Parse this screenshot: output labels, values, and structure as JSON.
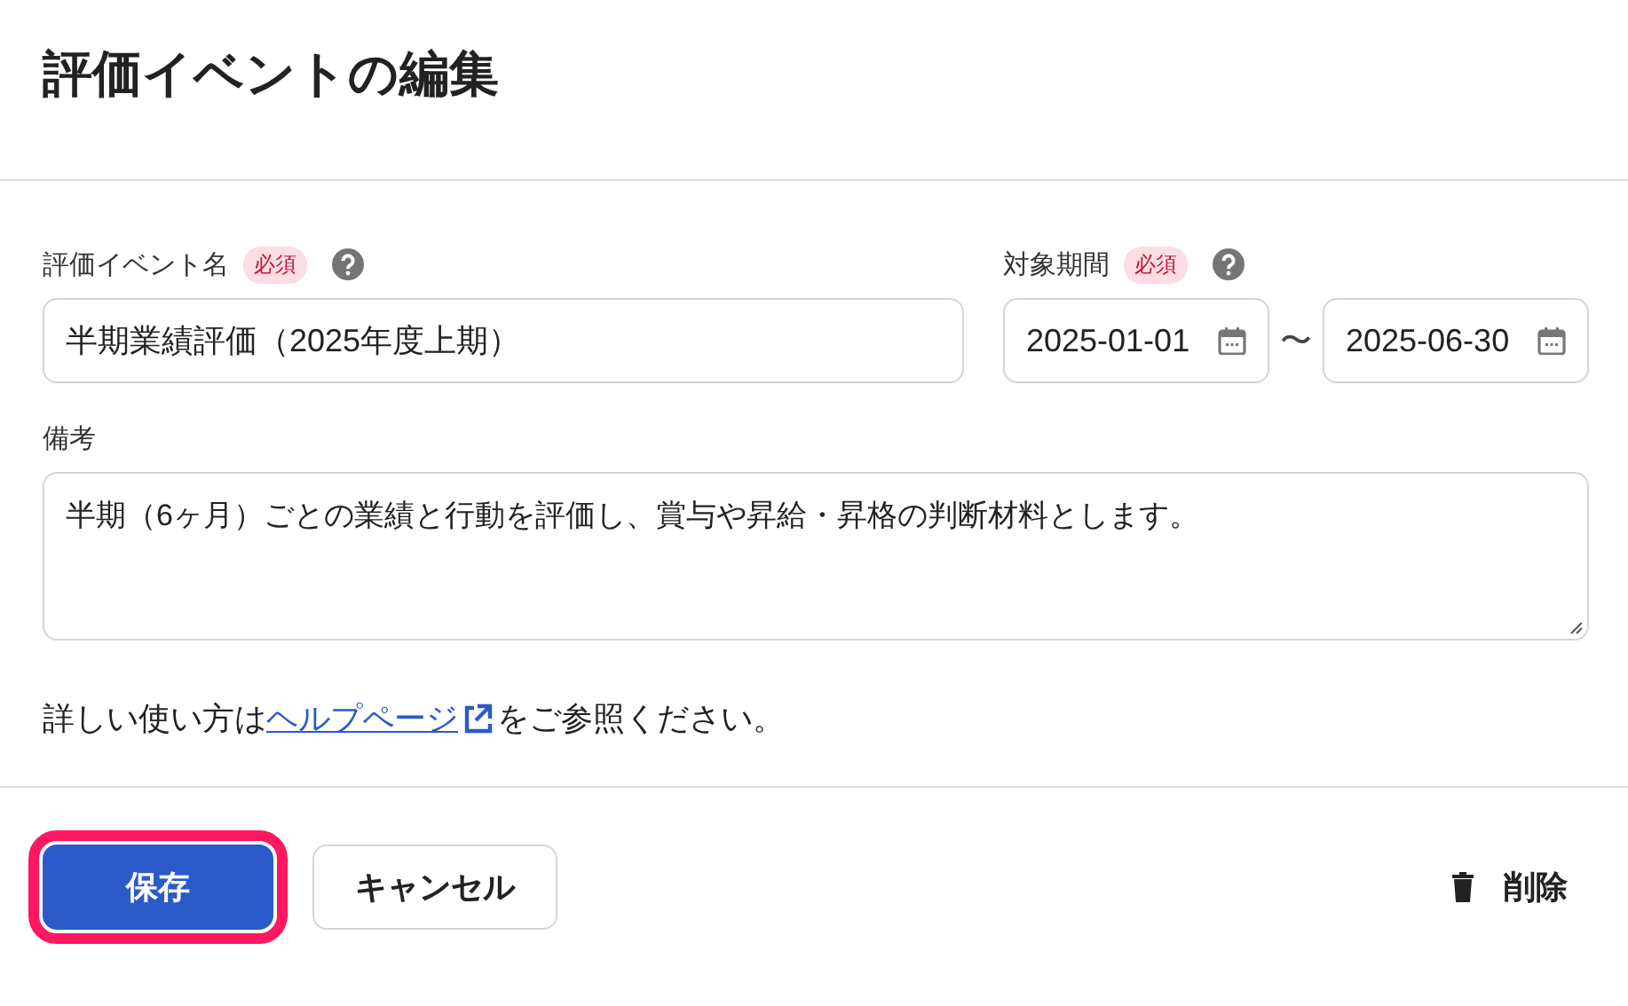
{
  "title": "評価イベントの編集",
  "name_field": {
    "label": "評価イベント名",
    "required_badge": "必須",
    "value": "半期業績評価（2025年度上期）"
  },
  "period_field": {
    "label": "対象期間",
    "required_badge": "必須",
    "start": "2025-01-01",
    "separator": "〜",
    "end": "2025-06-30"
  },
  "notes_field": {
    "label": "備考",
    "value": "半期（6ヶ月）ごとの業績と行動を評価し、賞与や昇給・昇格の判断材料とします。"
  },
  "help": {
    "prefix": "詳しい使い方は",
    "link": "ヘルプページ",
    "suffix": "をご参照ください。"
  },
  "buttons": [
    {
      "kind": "primary",
      "label": "保存",
      "focused": true
    },
    {
      "kind": "secondary",
      "label": "キャンセル",
      "focused": false
    },
    {
      "kind": "delete",
      "label": "削除",
      "focused": false
    }
  ]
}
